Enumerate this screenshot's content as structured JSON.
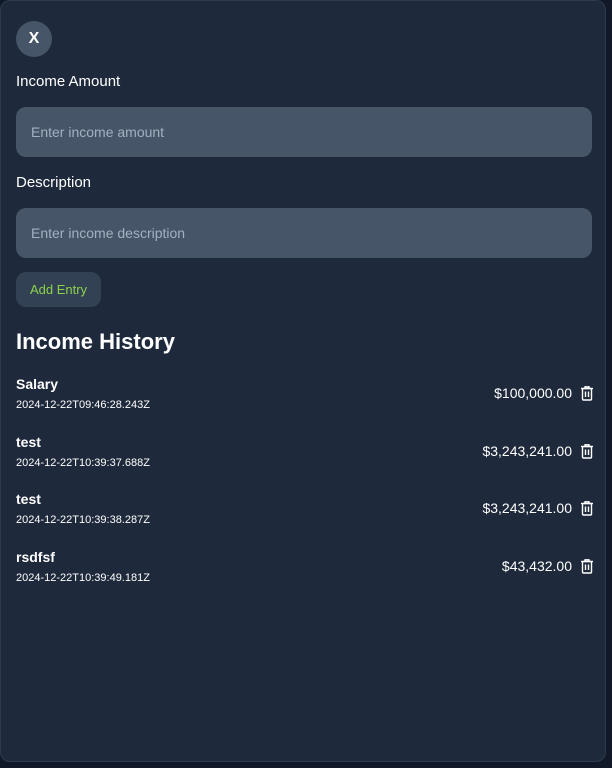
{
  "close_label": "X",
  "form": {
    "amount_label": "Income Amount",
    "amount_placeholder": "Enter income amount",
    "amount_value": "",
    "description_label": "Description",
    "description_placeholder": "Enter income description",
    "description_value": "",
    "add_label": "Add Entry"
  },
  "history": {
    "title": "Income History",
    "entries": [
      {
        "description": "Salary",
        "date": "2024-12-22T09:46:28.243Z",
        "amount": "$100,000.00",
        "icon": "trash-icon"
      },
      {
        "description": "test",
        "date": "2024-12-22T10:39:37.688Z",
        "amount": "$3,243,241.00",
        "icon": "trash-icon"
      },
      {
        "description": "test",
        "date": "2024-12-22T10:39:38.287Z",
        "amount": "$3,243,241.00",
        "icon": "trash-icon"
      },
      {
        "description": "rsdfsf",
        "date": "2024-12-22T10:39:49.181Z",
        "amount": "$43,432.00",
        "icon": "trash-icon"
      }
    ]
  },
  "colors": {
    "panel_bg": "#1e293b",
    "input_bg": "#475569",
    "button_bg": "#334155",
    "accent_green": "#8bd14a",
    "text": "#ffffff"
  }
}
